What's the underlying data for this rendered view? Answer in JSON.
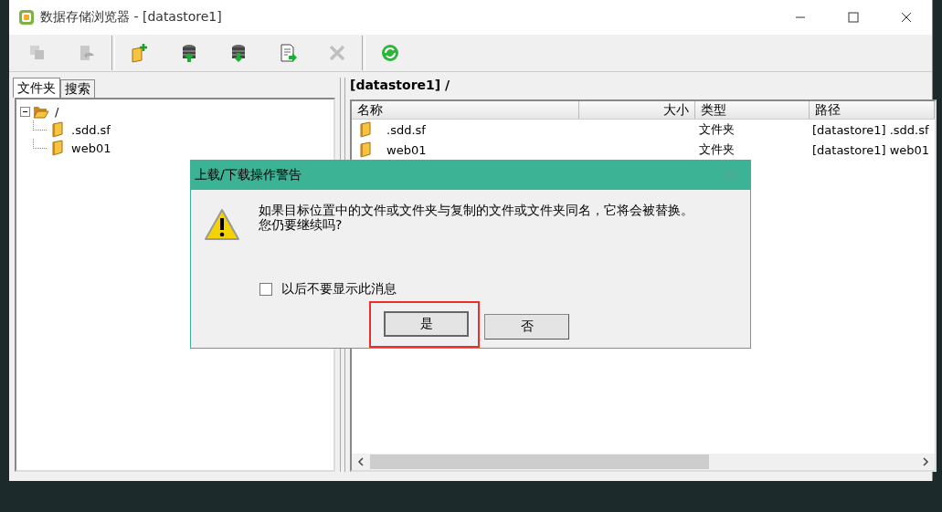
{
  "window": {
    "title": "数据存储浏览器 - [datastore1]"
  },
  "toolbar": [
    {
      "kind": "copy",
      "disabled": true
    },
    {
      "kind": "move",
      "disabled": true
    },
    {
      "kind": "new-folder",
      "disabled": false
    },
    {
      "kind": "upload",
      "disabled": false
    },
    {
      "kind": "download",
      "disabled": false
    },
    {
      "kind": "export",
      "disabled": false
    },
    {
      "kind": "delete",
      "disabled": true
    },
    {
      "kind": "refresh",
      "disabled": false
    }
  ],
  "tabs": [
    {
      "label": "文件夹",
      "selected": true
    },
    {
      "label": "搜索",
      "selected": false
    }
  ],
  "tree": [
    {
      "label": "/",
      "expanded": true,
      "children": [
        {
          "label": ".sdd.sf"
        },
        {
          "label": "web01"
        }
      ]
    }
  ],
  "location": "[datastore1] /",
  "table": {
    "columns": [
      "名称",
      "大小",
      "类型",
      "路径"
    ],
    "rows": [
      {
        "name": ".sdd.sf",
        "type": "文件夹",
        "path": "[datastore1] .sdd.sf"
      },
      {
        "name": "web01",
        "type": "文件夹",
        "path": "[datastore1] web01"
      }
    ]
  },
  "dialog": {
    "title": "上载/下载操作警告",
    "message": [
      "如果目标位置中的文件或文件夹与复制的文件或文件夹同名，它将会被替换。",
      "您仍要继续吗?"
    ],
    "checkbox": {
      "label": "以后不要显示此消息",
      "checked": false
    },
    "buttons": [
      {
        "label": "是",
        "selected": true
      },
      {
        "label": "否",
        "selected": false
      }
    ]
  }
}
